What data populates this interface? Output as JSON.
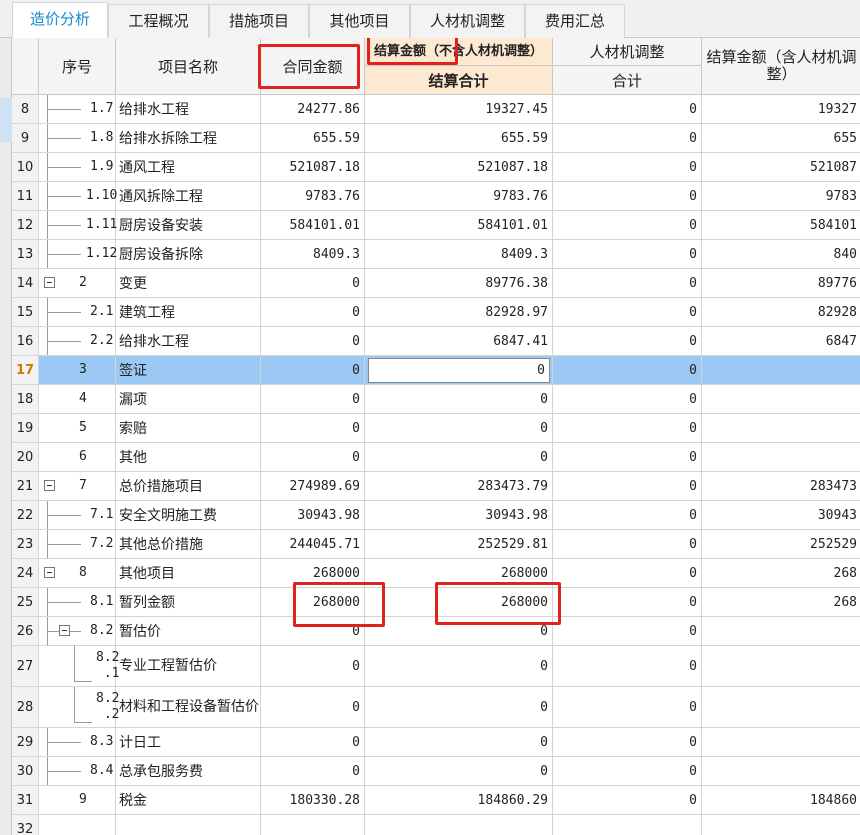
{
  "tabs": [
    {
      "label": "造价分析",
      "active": true
    },
    {
      "label": "工程概况",
      "active": false
    },
    {
      "label": "措施项目",
      "active": false
    },
    {
      "label": "其他项目",
      "active": false
    },
    {
      "label": "人材机调整",
      "active": false
    },
    {
      "label": "费用汇总",
      "active": false
    }
  ],
  "header": {
    "seq": "序号",
    "name": "项目名称",
    "contract_amount": "合同金额",
    "settle_group": "结算金额（不含人材机调整）",
    "settle_total": "结算合计",
    "labor_group": "人材机调整",
    "labor_total": "合计",
    "settle_incl": "结算金额（含人材机调整）"
  },
  "rows": [
    {
      "rn": "8",
      "seq": "1.7",
      "name": "给排水工程",
      "contract": "24277.86",
      "settle": "19327.45",
      "adj": "0",
      "incl": "19327"
    },
    {
      "rn": "9",
      "seq": "1.8",
      "name": "给排水拆除工程",
      "contract": "655.59",
      "settle": "655.59",
      "adj": "0",
      "incl": "655"
    },
    {
      "rn": "10",
      "seq": "1.9",
      "name": "通风工程",
      "contract": "521087.18",
      "settle": "521087.18",
      "adj": "0",
      "incl": "521087"
    },
    {
      "rn": "11",
      "seq": "1.10",
      "name": "通风拆除工程",
      "contract": "9783.76",
      "settle": "9783.76",
      "adj": "0",
      "incl": "9783"
    },
    {
      "rn": "12",
      "seq": "1.11",
      "name": "厨房设备安装",
      "contract": "584101.01",
      "settle": "584101.01",
      "adj": "0",
      "incl": "584101"
    },
    {
      "rn": "13",
      "seq": "1.12",
      "name": "厨房设备拆除",
      "contract": "8409.3",
      "settle": "8409.3",
      "adj": "0",
      "incl": "840"
    },
    {
      "rn": "14",
      "seq": "2",
      "name": "变更",
      "contract": "0",
      "settle": "89776.38",
      "adj": "0",
      "incl": "89776"
    },
    {
      "rn": "15",
      "seq": "2.1",
      "name": "建筑工程",
      "contract": "0",
      "settle": "82928.97",
      "adj": "0",
      "incl": "82928"
    },
    {
      "rn": "16",
      "seq": "2.2",
      "name": "给排水工程",
      "contract": "0",
      "settle": "6847.41",
      "adj": "0",
      "incl": "6847"
    },
    {
      "rn": "17",
      "seq": "3",
      "name": "签证",
      "contract": "0",
      "settle": "0",
      "adj": "0",
      "incl": ""
    },
    {
      "rn": "18",
      "seq": "4",
      "name": "漏项",
      "contract": "0",
      "settle": "0",
      "adj": "0",
      "incl": ""
    },
    {
      "rn": "19",
      "seq": "5",
      "name": "索赔",
      "contract": "0",
      "settle": "0",
      "adj": "0",
      "incl": ""
    },
    {
      "rn": "20",
      "seq": "6",
      "name": "其他",
      "contract": "0",
      "settle": "0",
      "adj": "0",
      "incl": ""
    },
    {
      "rn": "21",
      "seq": "7",
      "name": "总价措施项目",
      "contract": "274989.69",
      "settle": "283473.79",
      "adj": "0",
      "incl": "283473"
    },
    {
      "rn": "22",
      "seq": "7.1",
      "name": "安全文明施工费",
      "contract": "30943.98",
      "settle": "30943.98",
      "adj": "0",
      "incl": "30943"
    },
    {
      "rn": "23",
      "seq": "7.2",
      "name": "其他总价措施",
      "contract": "244045.71",
      "settle": "252529.81",
      "adj": "0",
      "incl": "252529"
    },
    {
      "rn": "24",
      "seq": "8",
      "name": "其他项目",
      "contract": "268000",
      "settle": "268000",
      "adj": "0",
      "incl": "268"
    },
    {
      "rn": "25",
      "seq": "8.1",
      "name": "暂列金额",
      "contract": "268000",
      "settle": "268000",
      "adj": "0",
      "incl": "268"
    },
    {
      "rn": "26",
      "seq": "8.2",
      "name": "暂估价",
      "contract": "0",
      "settle": "0",
      "adj": "0",
      "incl": ""
    },
    {
      "rn": "27",
      "seq": "8.2\n.1",
      "name": "专业工程暂估价",
      "contract": "0",
      "settle": "0",
      "adj": "0",
      "incl": ""
    },
    {
      "rn": "28",
      "seq": "8.2\n.2",
      "name": "材料和工程设备暂估价",
      "contract": "0",
      "settle": "0",
      "adj": "0",
      "incl": ""
    },
    {
      "rn": "29",
      "seq": "8.3",
      "name": "计日工",
      "contract": "0",
      "settle": "0",
      "adj": "0",
      "incl": ""
    },
    {
      "rn": "30",
      "seq": "8.4",
      "name": "总承包服务费",
      "contract": "0",
      "settle": "0",
      "adj": "0",
      "incl": ""
    },
    {
      "rn": "31",
      "seq": "9",
      "name": "税金",
      "contract": "180330.28",
      "settle": "184860.29",
      "adj": "0",
      "incl": "184860"
    },
    {
      "rn": "32",
      "seq": "",
      "name": "",
      "contract": "",
      "settle": "",
      "adj": "",
      "incl": ""
    }
  ],
  "colors": {
    "accent": "#1a8ad4",
    "highlight_row": "#9cc9f3",
    "orange_header": "#fde9d2",
    "annotation_red": "#e0221b"
  }
}
